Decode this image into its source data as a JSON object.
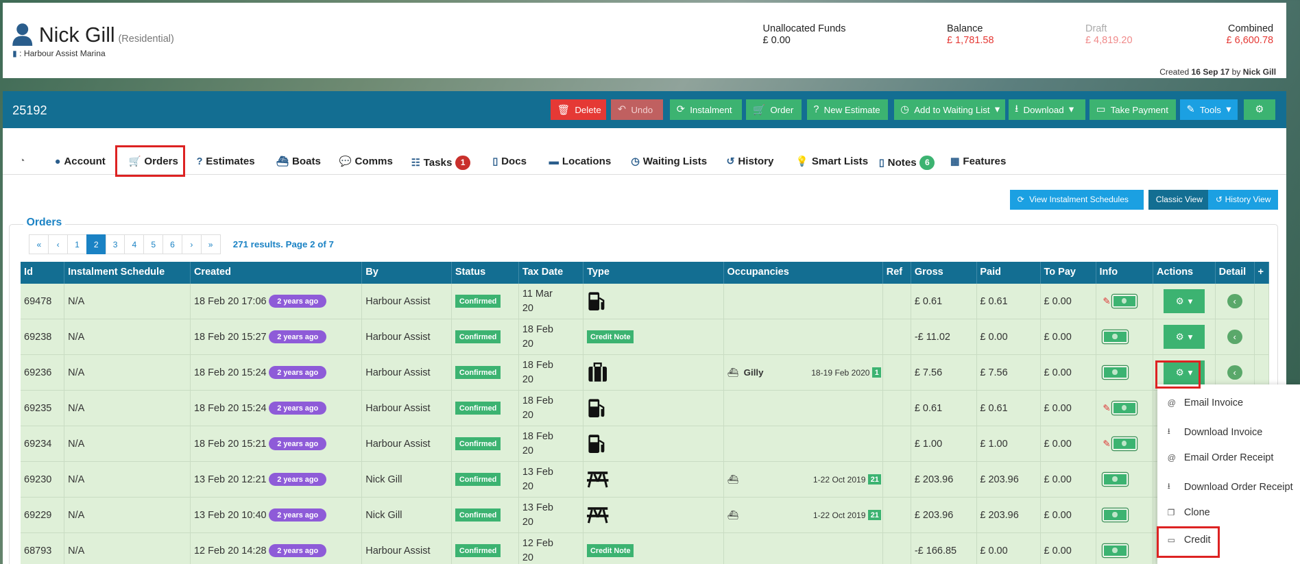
{
  "customer": {
    "name": "Nick Gill",
    "type": "(Residential)",
    "marina": ": Harbour Assist Marina"
  },
  "funds": [
    {
      "label": "Unallocated Funds",
      "value": "£ 0.00",
      "color": "#222222"
    },
    {
      "label": "Balance",
      "value": "£ 1,781.58",
      "color": "#e53935"
    },
    {
      "label": "Draft",
      "value": "£ 4,819.20",
      "color": "#f08a8a"
    },
    {
      "label": "Combined",
      "value": "£ 6,600.78",
      "color": "#e53935"
    }
  ],
  "created": {
    "prefix": "Created",
    "date": "16 Sep 17",
    "by": "by",
    "user": "Nick Gill"
  },
  "account_number": "25192",
  "toolbar": [
    "Delete",
    "Undo",
    "Instalment",
    "Order",
    "New Estimate",
    "Add to Waiting List",
    "Download",
    "Take Payment",
    "Tools"
  ],
  "tabs": [
    "Account",
    "Orders",
    "Estimates",
    "Boats",
    "Comms",
    "Tasks",
    "Docs",
    "Locations",
    "Waiting Lists",
    "History",
    "Smart Lists",
    "Notes",
    "Features"
  ],
  "tab_badges": {
    "tasks": "1",
    "notes": "6"
  },
  "view_buttons": {
    "schedules": "View Instalment Schedules",
    "classic": "Classic View",
    "history": "History View"
  },
  "orders_title": "Orders",
  "pagination": {
    "pages": [
      "«",
      "‹",
      "1",
      "2",
      "3",
      "4",
      "5",
      "6",
      "›",
      "»"
    ],
    "active": "2",
    "info": "271 results. Page 2 of 7"
  },
  "columns": [
    "Id",
    "Instalment Schedule",
    "Created",
    "By",
    "Status",
    "Tax Date",
    "Type",
    "Occupancies",
    "Ref",
    "Gross",
    "Paid",
    "To Pay",
    "Info",
    "Actions",
    "Detail",
    "+"
  ],
  "rows": [
    {
      "id": "69478",
      "sched": "N/A",
      "created": "18 Feb 20 17:06",
      "ago": "2 years ago",
      "by": "Harbour Assist",
      "status": "Confirmed",
      "tax1": "11 Mar",
      "tax2": "20",
      "type": "fuel",
      "occ_name": "",
      "occ_dates": "",
      "occ_n": "",
      "gross": "£ 0.61",
      "paid": "£ 0.61",
      "topay": "£ 0.00",
      "pencil": true,
      "actions": true
    },
    {
      "id": "69238",
      "sched": "N/A",
      "created": "18 Feb 20 15:27",
      "ago": "2 years ago",
      "by": "Harbour Assist",
      "status": "Confirmed",
      "tax1": "18 Feb",
      "tax2": "20",
      "type": "credit",
      "type_label": "Credit Note",
      "occ_name": "",
      "occ_dates": "",
      "occ_n": "",
      "gross": "-£ 11.02",
      "paid": "£ 0.00",
      "topay": "£ 0.00",
      "pencil": false,
      "actions": true
    },
    {
      "id": "69236",
      "sched": "N/A",
      "created": "18 Feb 20 15:24",
      "ago": "2 years ago",
      "by": "Harbour Assist",
      "status": "Confirmed",
      "tax1": "18 Feb",
      "tax2": "20",
      "type": "luggage",
      "occ_name": "Gilly",
      "occ_dates": "18-19 Feb 2020",
      "occ_n": "1",
      "gross": "£ 7.56",
      "paid": "£ 7.56",
      "topay": "£ 0.00",
      "pencil": false,
      "actions": true
    },
    {
      "id": "69235",
      "sched": "N/A",
      "created": "18 Feb 20 15:24",
      "ago": "2 years ago",
      "by": "Harbour Assist",
      "status": "Confirmed",
      "tax1": "18 Feb",
      "tax2": "20",
      "type": "fuel",
      "occ_name": "",
      "occ_dates": "",
      "occ_n": "",
      "gross": "£ 0.61",
      "paid": "£ 0.61",
      "topay": "£ 0.00",
      "pencil": true,
      "actions": false
    },
    {
      "id": "69234",
      "sched": "N/A",
      "created": "18 Feb 20 15:21",
      "ago": "2 years ago",
      "by": "Harbour Assist",
      "status": "Confirmed",
      "tax1": "18 Feb",
      "tax2": "20",
      "type": "fuel",
      "occ_name": "",
      "occ_dates": "",
      "occ_n": "",
      "gross": "£ 1.00",
      "paid": "£ 1.00",
      "topay": "£ 0.00",
      "pencil": true,
      "actions": false
    },
    {
      "id": "69230",
      "sched": "N/A",
      "created": "13 Feb 20 12:21",
      "ago": "2 years ago",
      "by": "Nick Gill",
      "status": "Confirmed",
      "tax1": "13 Feb",
      "tax2": "20",
      "type": "table",
      "occ_name": "",
      "occ_dates": "1-22 Oct 2019",
      "occ_n": "21",
      "gross": "£ 203.96",
      "paid": "£ 203.96",
      "topay": "£ 0.00",
      "pencil": false,
      "actions": false
    },
    {
      "id": "69229",
      "sched": "N/A",
      "created": "13 Feb 20 10:40",
      "ago": "2 years ago",
      "by": "Nick Gill",
      "status": "Confirmed",
      "tax1": "13 Feb",
      "tax2": "20",
      "type": "table",
      "occ_name": "",
      "occ_dates": "1-22 Oct 2019",
      "occ_n": "21",
      "gross": "£ 203.96",
      "paid": "£ 203.96",
      "topay": "£ 0.00",
      "pencil": false,
      "actions": false
    },
    {
      "id": "68793",
      "sched": "N/A",
      "created": "12 Feb 20 14:28",
      "ago": "2 years ago",
      "by": "Harbour Assist",
      "status": "Confirmed",
      "tax1": "12 Feb",
      "tax2": "20",
      "type": "credit",
      "type_label": "Credit Note",
      "occ_name": "",
      "occ_dates": "",
      "occ_n": "",
      "gross": "-£ 166.85",
      "paid": "£ 0.00",
      "topay": "£ 0.00",
      "pencil": false,
      "actions": false
    }
  ],
  "menu": [
    {
      "label": "Email Invoice",
      "icon": "at-icon"
    },
    {
      "label": "Download Invoice",
      "icon": "download-icon"
    },
    {
      "label": "Email Order Receipt",
      "icon": "at-icon"
    },
    {
      "label": "Download Order Receipt",
      "icon": "download-icon"
    },
    {
      "label": "Clone",
      "icon": "clone-icon"
    },
    {
      "label": "Credit",
      "icon": "money-icon"
    }
  ]
}
